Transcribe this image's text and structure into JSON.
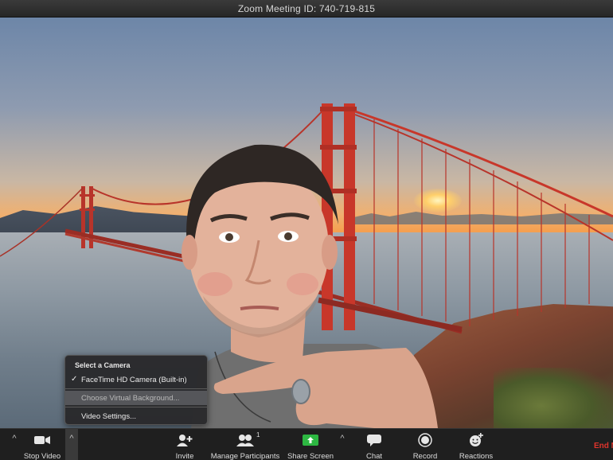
{
  "window": {
    "title": "Zoom Meeting ID: 740-719-815"
  },
  "camera_menu": {
    "header": "Select a Camera",
    "items": [
      {
        "label": "FaceTime HD Camera (Built-in)",
        "checked": true
      },
      {
        "label": "Choose Virtual Background...",
        "highlighted": true
      },
      {
        "label": "Video Settings..."
      }
    ]
  },
  "toolbar": {
    "stop_video": "Stop Video",
    "invite": "Invite",
    "manage_participants": "Manage Participants",
    "participant_count": "1",
    "share_screen": "Share Screen",
    "chat": "Chat",
    "record": "Record",
    "reactions": "Reactions",
    "end": "End M"
  },
  "colors": {
    "share_green": "#2db742",
    "end_red": "#e0342c",
    "bridge_red": "#c8372a"
  }
}
